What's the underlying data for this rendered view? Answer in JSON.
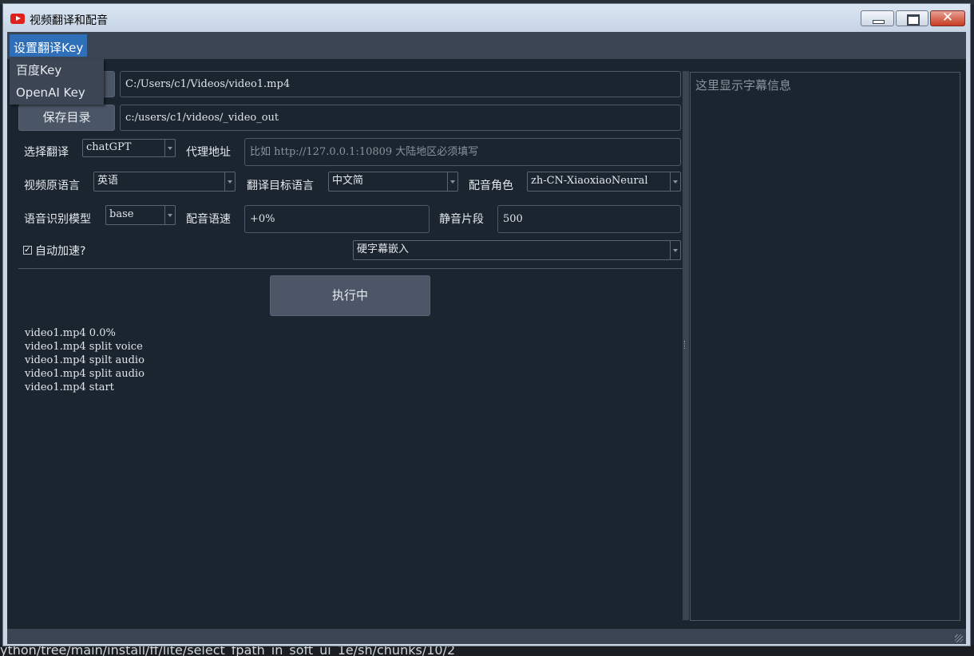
{
  "window": {
    "title": "视频翻译和配音"
  },
  "menu": {
    "settings": "设置翻译Key",
    "items": [
      "百度Key",
      "OpenAI Key"
    ]
  },
  "source_video": {
    "value": "C:/Users/c1/Videos/video1.mp4"
  },
  "output_dir": {
    "button": "保存目录",
    "value": "c:/users/c1/videos/_video_out"
  },
  "translate": {
    "label": "选择翻译",
    "value": "chatGPT"
  },
  "proxy": {
    "label": "代理地址",
    "placeholder": "比如 http://127.0.0.1:10809 大陆地区必须填写"
  },
  "source_lang": {
    "label": "视频原语言",
    "value": "英语"
  },
  "target_lang": {
    "label": "翻译目标语言",
    "value": "中文简"
  },
  "voice_role": {
    "label": "配音角色",
    "value": "zh-CN-XiaoxiaoNeural"
  },
  "asr_model": {
    "label": "语音识别模型",
    "value": "base"
  },
  "voice_rate": {
    "label": "配音语速",
    "value": "+0%"
  },
  "silence": {
    "label": "静音片段",
    "value": "500"
  },
  "auto_speed": {
    "label": "自动加速?",
    "checked": true
  },
  "subtitle_mode": {
    "value": "硬字幕嵌入"
  },
  "run_button": {
    "label": "执行中"
  },
  "log_lines": [
    "video1.mp4 0.0%",
    "video1.mp4 split voice",
    "video1.mp4 spilt audio",
    "video1.mp4 split audio",
    "video1.mp4 start"
  ],
  "subtitle_panel": {
    "placeholder": "这里显示字幕信息"
  },
  "background_text": "ython/tree/main/install/ff/lite/select_fpath_in_soft_ui_1e/sh/chunks/10/2"
}
